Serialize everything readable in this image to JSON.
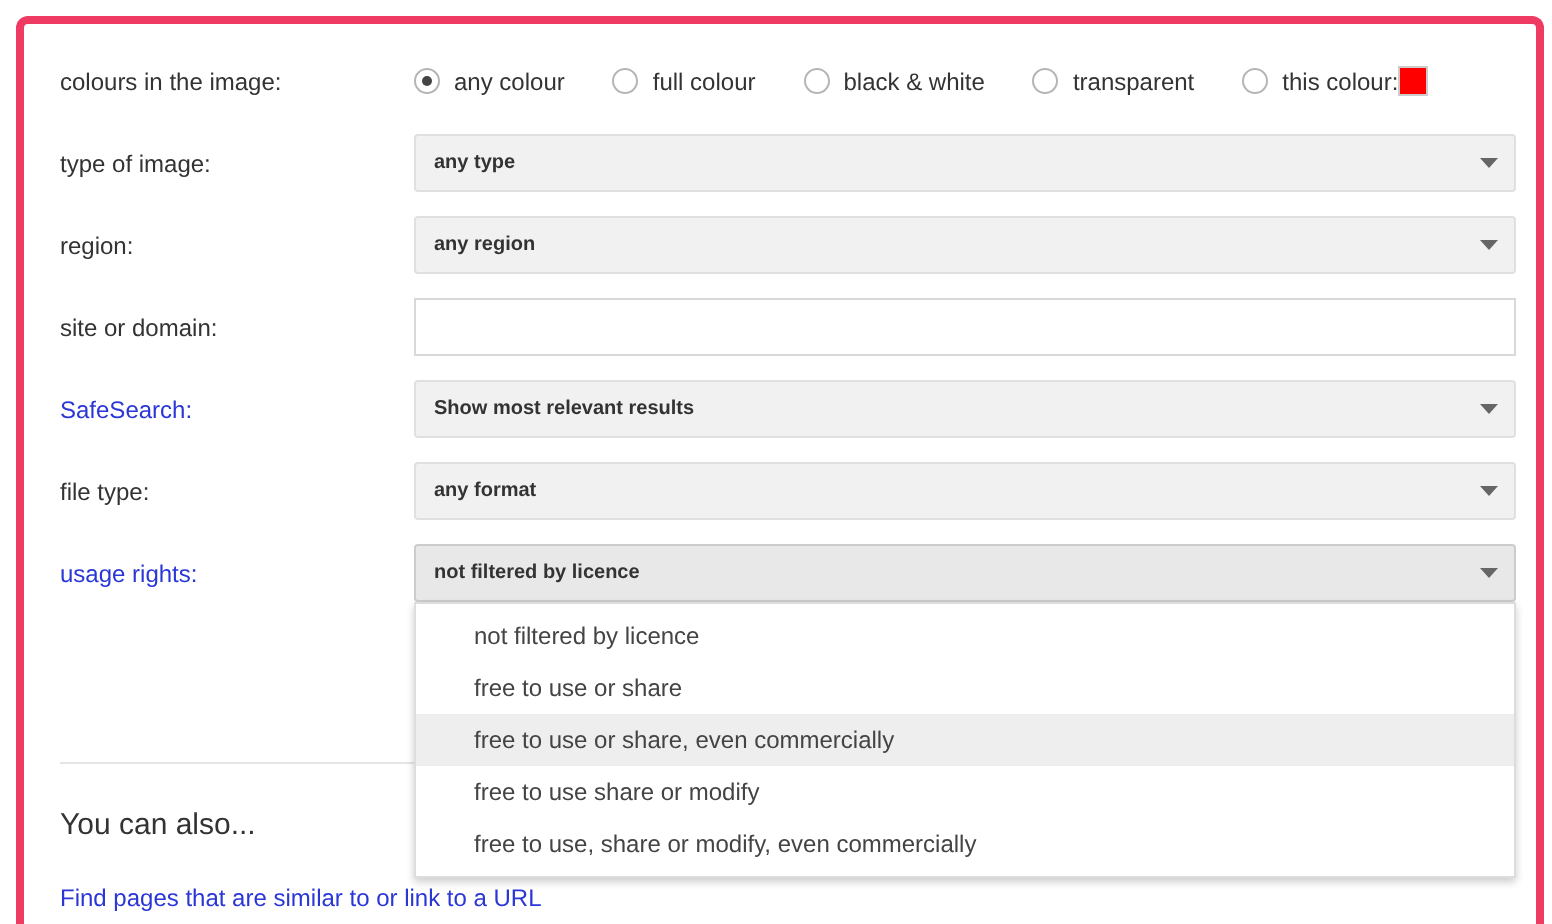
{
  "colour_options": [
    {
      "label": "any colour",
      "selected": true
    },
    {
      "label": "full colour",
      "selected": false
    },
    {
      "label": "black & white",
      "selected": false
    },
    {
      "label": "transparent",
      "selected": false
    },
    {
      "label": "this colour:",
      "selected": false,
      "color": "#ff0000"
    }
  ],
  "colour_label": "colours in the image:",
  "fields": [
    {
      "kind": "select",
      "label": "type of image:",
      "link": false,
      "value": "any type"
    },
    {
      "kind": "select",
      "label": "region:",
      "link": false,
      "value": "any region"
    },
    {
      "kind": "text",
      "label": "site or domain:",
      "link": false
    },
    {
      "kind": "select",
      "label": "SafeSearch:",
      "link": true,
      "value": "Show most relevant results"
    },
    {
      "kind": "select",
      "label": "file type:",
      "link": false,
      "value": "any format"
    },
    {
      "kind": "select",
      "label": "usage rights:",
      "link": true,
      "value": "not filtered by licence",
      "expanded": true
    }
  ],
  "dropdown_options": [
    {
      "label": "not filtered by licence",
      "selected": false
    },
    {
      "label": "free to use or share",
      "selected": false
    },
    {
      "label": "free to use or share, even commercially",
      "selected": true
    },
    {
      "label": "free to use share or modify",
      "selected": false
    },
    {
      "label": "free to use, share or modify, even commercially",
      "selected": false
    }
  ],
  "also_heading": "You can also...",
  "links": [
    "Find pages that are similar to or link to a URL"
  ]
}
